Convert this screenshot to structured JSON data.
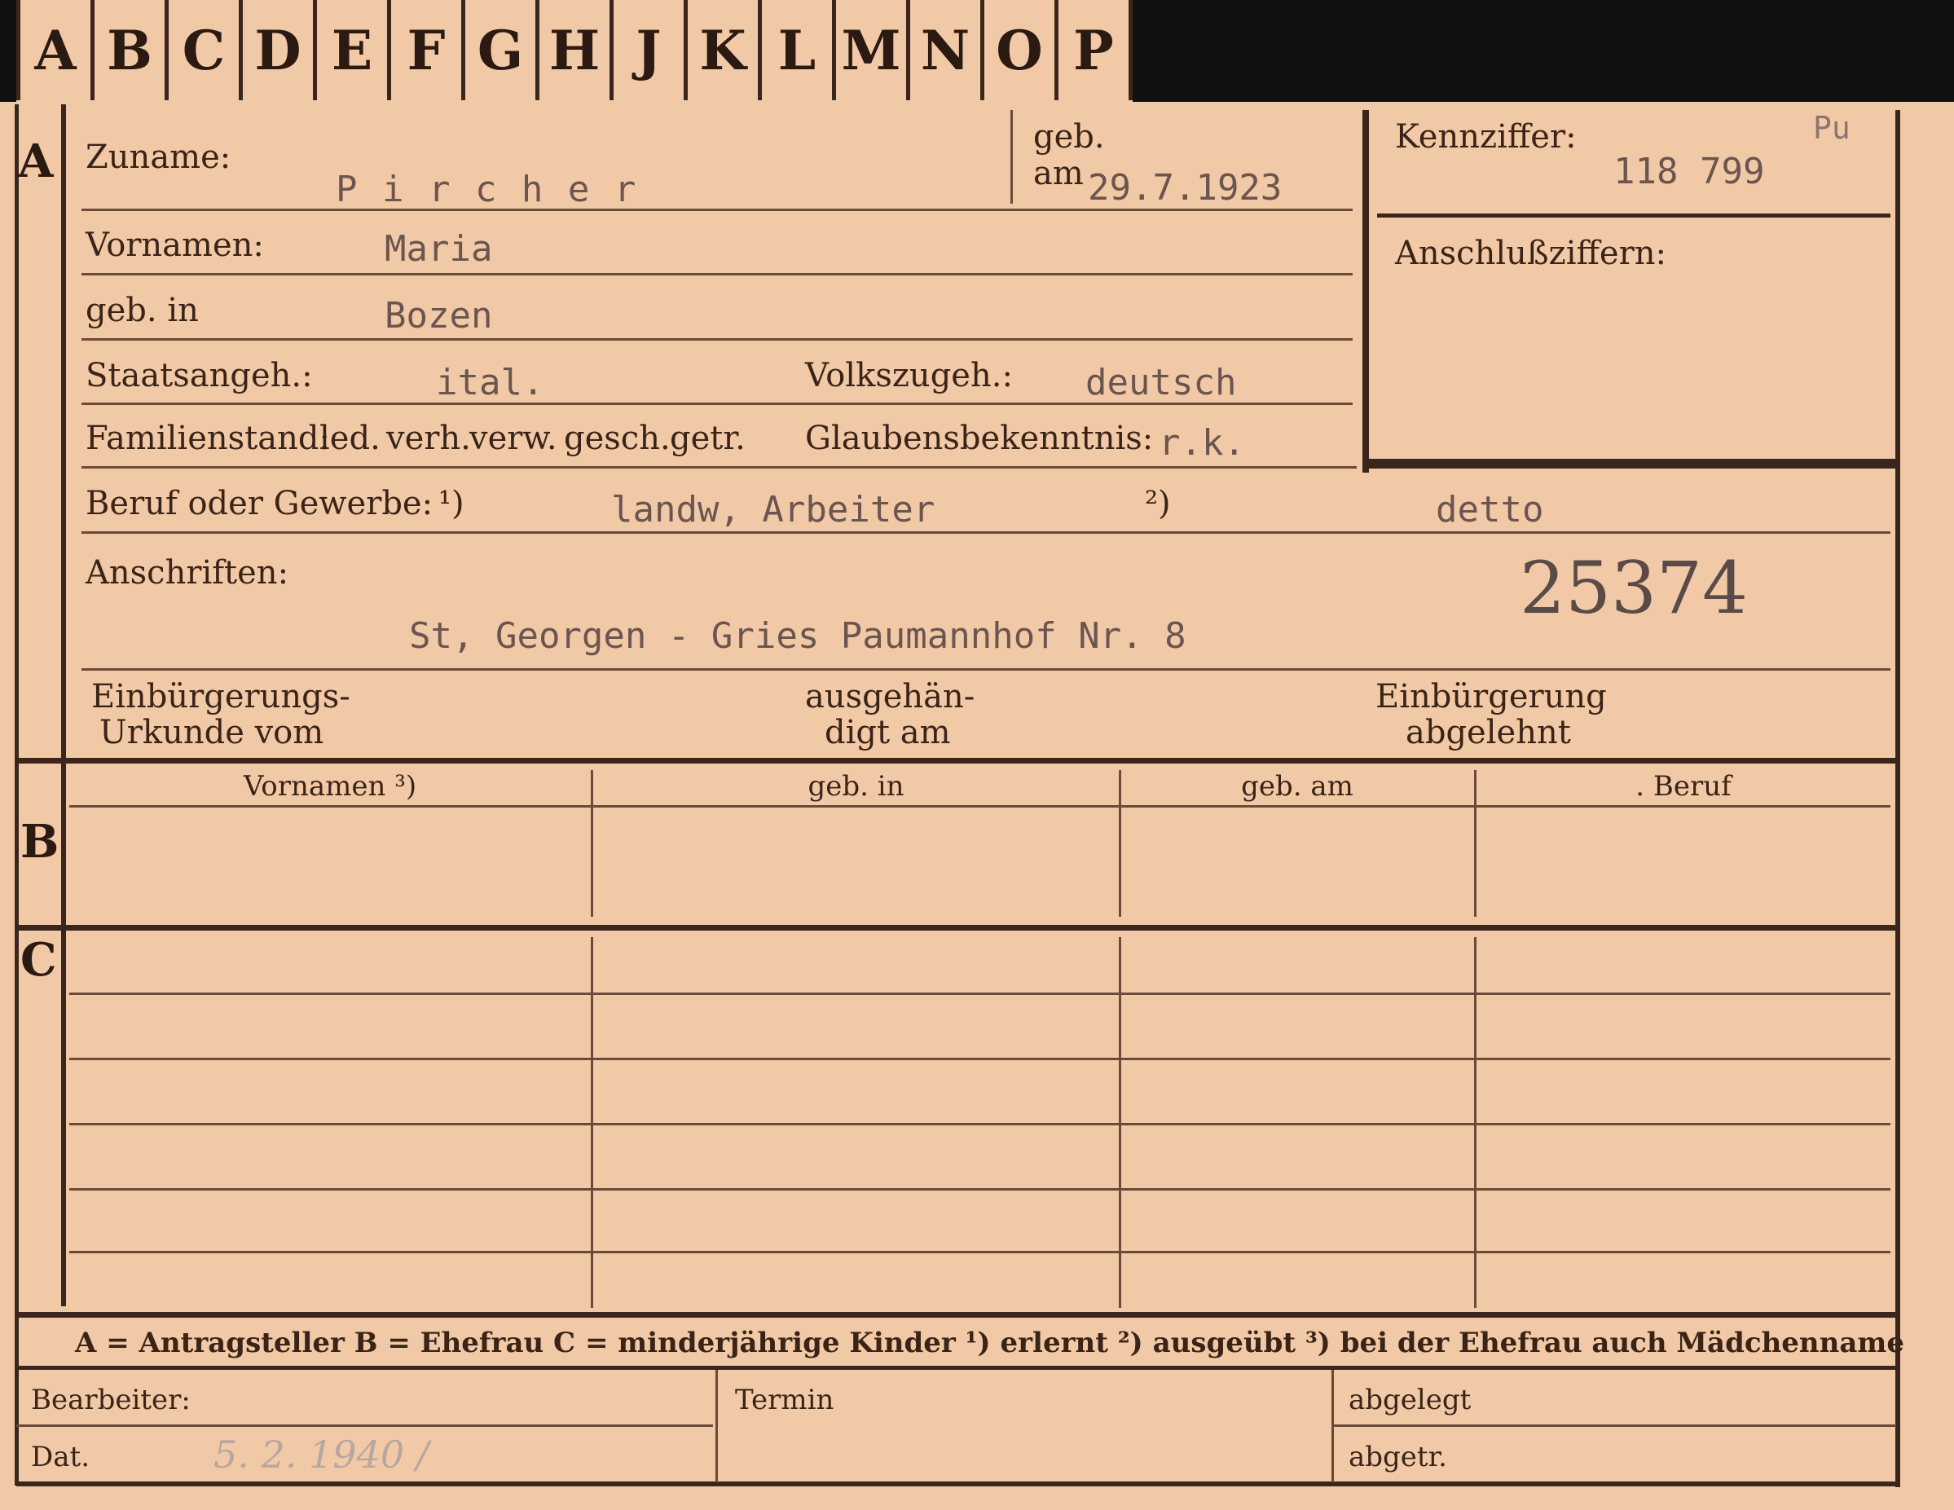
{
  "tabs": [
    "A",
    "B",
    "C",
    "D",
    "E",
    "F",
    "G",
    "H",
    "J",
    "K",
    "L",
    "M",
    "N",
    "O",
    "P"
  ],
  "section_a": {
    "marker": "A",
    "zuname_label": "Zuname:",
    "zuname_value": "P i r c h e r",
    "geb_label": "geb.",
    "am_label": "am",
    "geb_am_value": "29.7.1923",
    "kennziffer_label": "Kennziffer:",
    "kennziffer_value": "118 799",
    "kennziffer_note": "Pu",
    "anschluss_label": "Anschlußziffern:",
    "vornamen_label": "Vornamen:",
    "vornamen_value": "Maria",
    "geb_in_label": "geb. in",
    "geb_in_value": "Bozen",
    "staatsangeh_label": "Staatsangeh.:",
    "staatsangeh_value": "ital.",
    "volkszugeh_label": "Volkszugeh.:",
    "volkszugeh_value": "deutsch",
    "familienstand_label": "Familienstand:",
    "familienstand_options": [
      "led.",
      "verh.",
      "verw.",
      "gesch.",
      "getr."
    ],
    "glaubens_label": "Glaubensbekenntnis:",
    "glaubens_value": "r.k.",
    "beruf_label": "Beruf oder Gewerbe:",
    "beruf_mark1": "¹)",
    "beruf_value1": "landw, Arbeiter",
    "beruf_mark2": "²)",
    "beruf_value2": "detto",
    "anschriften_label": "Anschriften:",
    "anschriften_value": "St, Georgen - Gries Paumannhof Nr. 8",
    "stamp_number": "25374",
    "einb_urkunde_label1": "Einbürgerungs-",
    "einb_urkunde_label2": "Urkunde vom",
    "ausgehaendigt_label1": "ausgehän-",
    "ausgehaendigt_label2": "digt am",
    "einb_abgelehnt_label1": "Einbürgerung",
    "einb_abgelehnt_label2": "abgelehnt"
  },
  "section_b": {
    "marker": "B",
    "columns": [
      "Vornamen ³)",
      "geb. in",
      "geb. am",
      ". Beruf"
    ]
  },
  "section_c": {
    "marker": "C"
  },
  "legend": "A = Antragsteller   B = Ehefrau   C = minderjährige Kinder   ¹) erlernt   ²) ausgeübt   ³) bei der Ehefrau auch Mädchenname",
  "footer": {
    "bearbeiter_label": "Bearbeiter:",
    "dat_label": "Dat.",
    "dat_value": "5. 2. 1940 /",
    "termin_label": "Termin",
    "abgelegt_label": "abgelegt",
    "abgetr_label": "abgetr."
  },
  "colors": {
    "card": "#f2c9a6",
    "ink": "#3a2418",
    "type": "#6b5550",
    "background": "#111111"
  }
}
